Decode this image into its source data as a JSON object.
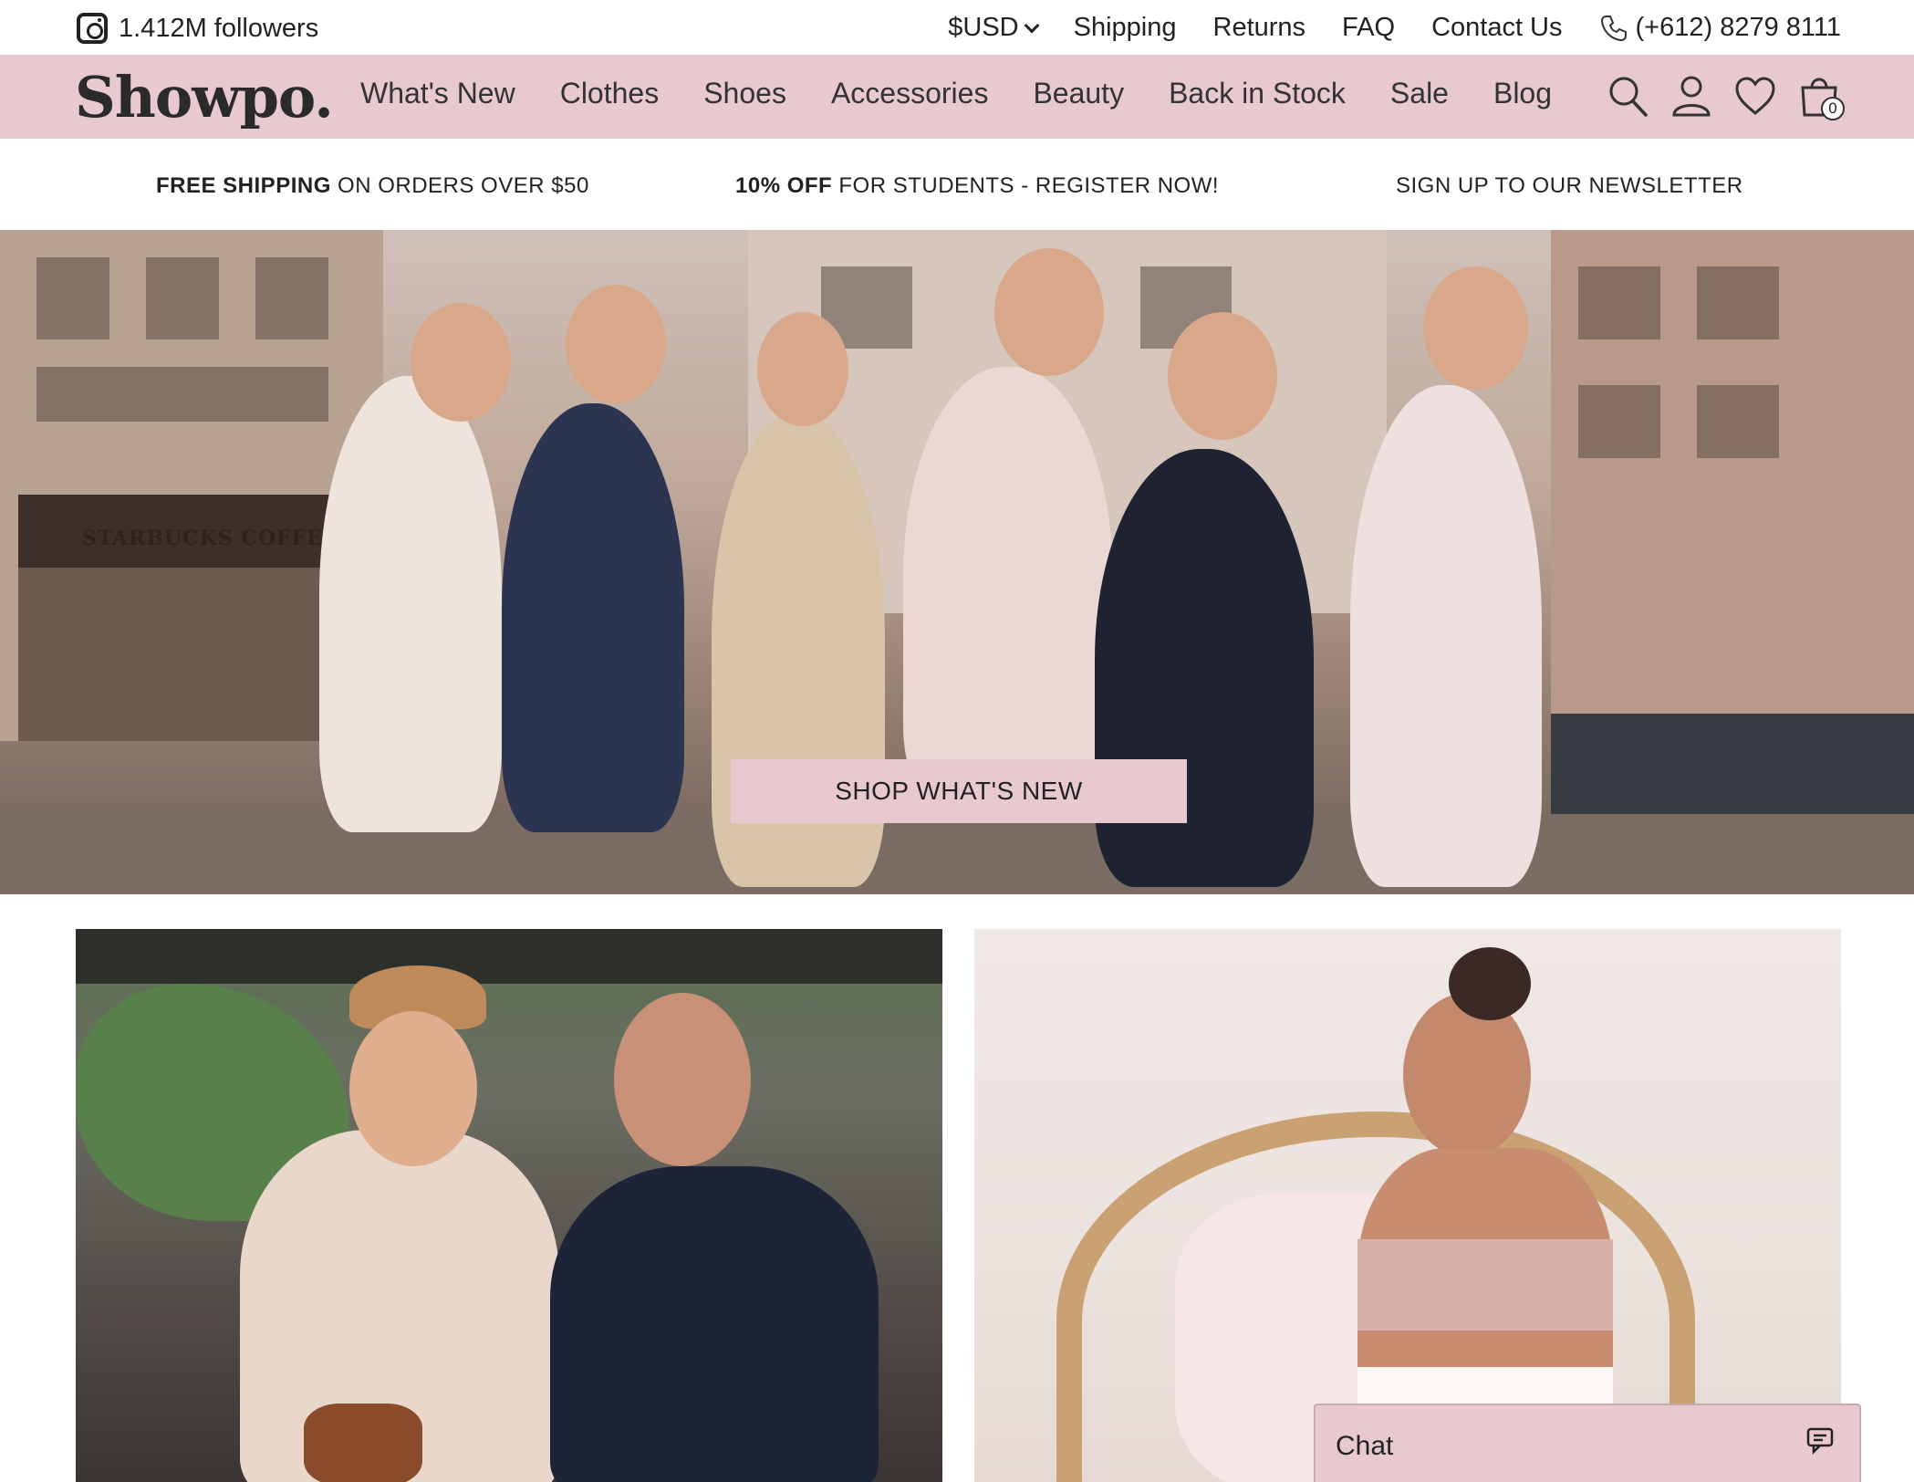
{
  "topbar": {
    "followers": "1.412M followers",
    "currency": "$USD",
    "links": [
      "Shipping",
      "Returns",
      "FAQ",
      "Contact Us"
    ],
    "phone": "(+612) 8279 8111"
  },
  "nav": {
    "logo": "Showpo.",
    "items": [
      "What's New",
      "Clothes",
      "Shoes",
      "Accessories",
      "Beauty",
      "Back in Stock",
      "Sale",
      "Blog"
    ],
    "cart_count": "0",
    "icons": [
      "search-icon",
      "account-icon",
      "heart-icon",
      "cart-icon"
    ]
  },
  "promo": {
    "shipping_bold": "FREE SHIPPING",
    "shipping_rest": " ON ORDERS OVER $50",
    "students_bold": "10% OFF",
    "students_rest": " FOR STUDENTS - REGISTER NOW!",
    "newsletter": "SIGN UP TO OUR NEWSLETTER"
  },
  "hero": {
    "cta": "SHOP WHAT'S NEW",
    "sign_text": "STARBUCKS COFFEE"
  },
  "chat": {
    "label": "Chat"
  },
  "colors": {
    "accent_pink": "#e8c9d0",
    "text_dark": "#2b2b2b"
  }
}
